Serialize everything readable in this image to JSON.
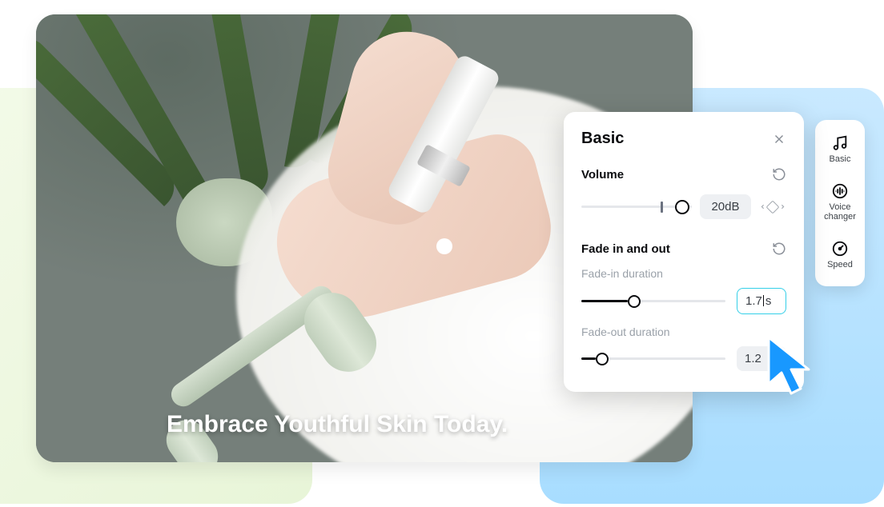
{
  "video": {
    "overlay_caption": "Embrace Youthful Skin Today."
  },
  "panel": {
    "title": "Basic",
    "volume": {
      "label": "Volume",
      "value_display": "20dB",
      "slider_percent": 85
    },
    "fade": {
      "section_label": "Fade in and out",
      "in_label": "Fade-in duration",
      "in_value": "1.7",
      "in_unit": "s",
      "in_slider_percent": 32,
      "out_label": "Fade-out duration",
      "out_value_display": "1.2",
      "out_slider_percent": 10
    }
  },
  "sidebar": {
    "items": [
      {
        "label": "Basic",
        "icon": "music-note-icon"
      },
      {
        "label": "Voice changer",
        "icon": "voice-wave-icon"
      },
      {
        "label": "Speed",
        "icon": "speed-gauge-icon"
      }
    ]
  }
}
